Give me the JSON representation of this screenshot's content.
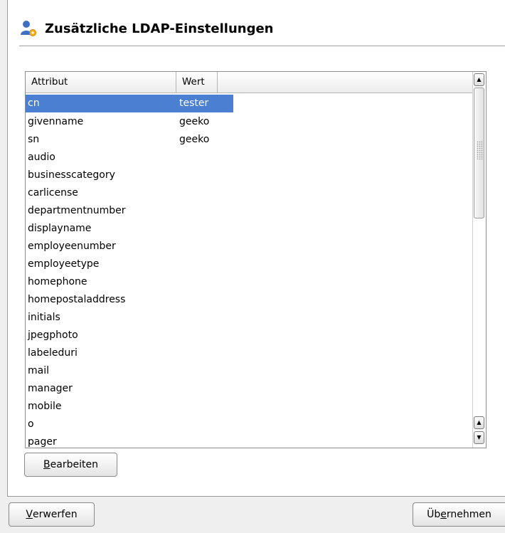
{
  "header": {
    "title": "Zusätzliche LDAP-Einstellungen",
    "icon": "user-settings-icon"
  },
  "table": {
    "columns": [
      "Attribut",
      "Wert"
    ],
    "rows": [
      {
        "attr": "cn",
        "value": "tester",
        "selected": true
      },
      {
        "attr": "givenname",
        "value": "geeko"
      },
      {
        "attr": "sn",
        "value": "geeko"
      },
      {
        "attr": "audio",
        "value": ""
      },
      {
        "attr": "businesscategory",
        "value": ""
      },
      {
        "attr": "carlicense",
        "value": ""
      },
      {
        "attr": "departmentnumber",
        "value": ""
      },
      {
        "attr": "displayname",
        "value": ""
      },
      {
        "attr": "employeenumber",
        "value": ""
      },
      {
        "attr": "employeetype",
        "value": ""
      },
      {
        "attr": "homephone",
        "value": ""
      },
      {
        "attr": "homepostaladdress",
        "value": ""
      },
      {
        "attr": "initials",
        "value": ""
      },
      {
        "attr": "jpegphoto",
        "value": ""
      },
      {
        "attr": "labeleduri",
        "value": ""
      },
      {
        "attr": "mail",
        "value": ""
      },
      {
        "attr": "manager",
        "value": ""
      },
      {
        "attr": "mobile",
        "value": ""
      },
      {
        "attr": "o",
        "value": ""
      },
      {
        "attr": "pager",
        "value": ""
      }
    ]
  },
  "buttons": {
    "edit": {
      "mnemonic": "B",
      "rest": "earbeiten"
    },
    "discard": {
      "mnemonic": "V",
      "rest": "erwerfen"
    },
    "apply": {
      "pre": "Üb",
      "mnemonic": "e",
      "rest": "rnehmen"
    }
  },
  "colors": {
    "selection": "#4b7fd2",
    "background": "#efefef"
  }
}
